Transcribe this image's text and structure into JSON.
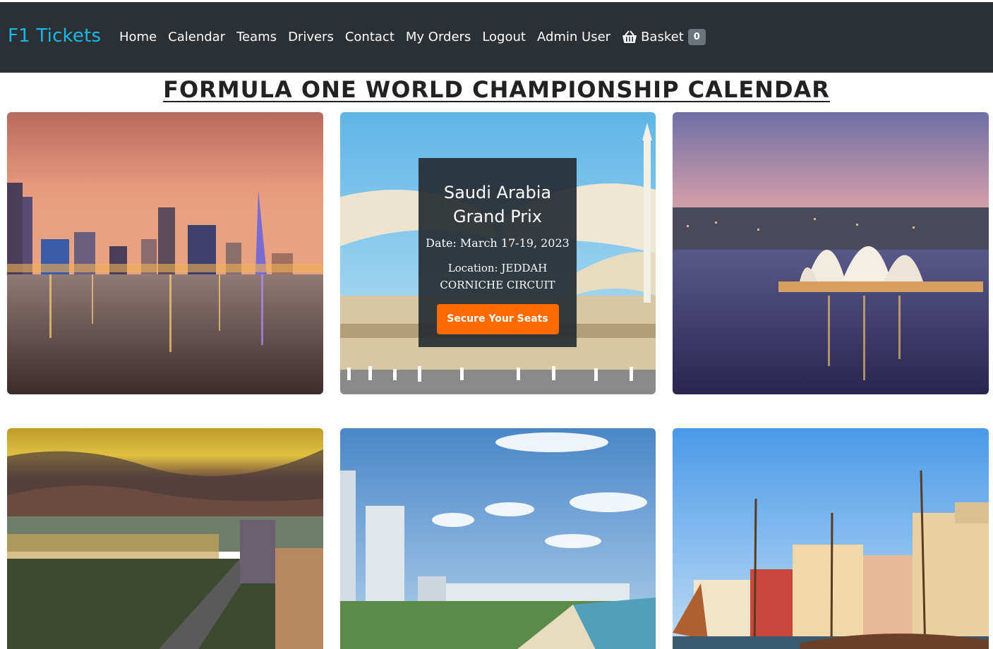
{
  "navbar": {
    "brand": "F1 Tickets",
    "links": [
      "Home",
      "Calendar",
      "Teams",
      "Drivers",
      "Contact",
      "My Orders",
      "Logout",
      "Admin User"
    ],
    "basket_label": "Basket",
    "basket_count": "0"
  },
  "page_title": "FORMULA ONE WORLD CHAMPIONSHIP CALENDAR",
  "featured_card": {
    "title": "Saudi Arabia Grand Prix",
    "date": "Date: March 17-19, 2023",
    "location": "Location: JEDDAH CORNICHE CIRCUIT",
    "button": "Secure Your Seats"
  },
  "icons": {
    "basket": "basket-icon"
  },
  "colors": {
    "navbar_bg": "#2b3035",
    "brand": "#1ab8e8",
    "button": "#ff6a00",
    "badge": "#6c757d"
  }
}
